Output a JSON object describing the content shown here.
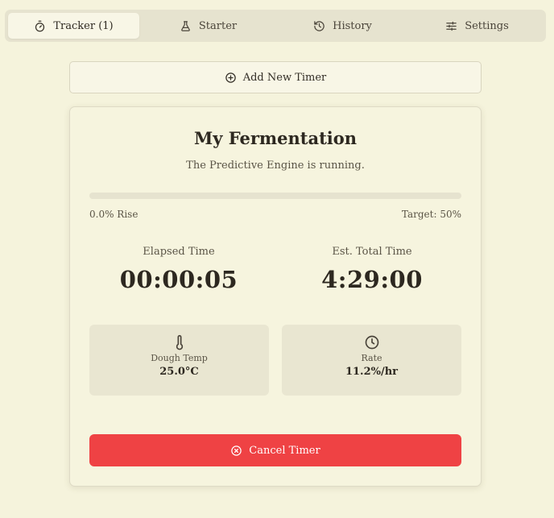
{
  "tabs": [
    {
      "label": "Tracker (1)",
      "icon": "stopwatch-icon",
      "active": true
    },
    {
      "label": "Starter",
      "icon": "flask-icon",
      "active": false
    },
    {
      "label": "History",
      "icon": "history-icon",
      "active": false
    },
    {
      "label": "Settings",
      "icon": "sliders-icon",
      "active": false
    }
  ],
  "add_timer": {
    "label": "Add New Timer",
    "icon": "plus-circle-icon"
  },
  "card": {
    "title": "My Fermentation",
    "subtitle": "The Predictive Engine is running.",
    "progress": {
      "value_percent": 0,
      "rise_label": "0.0% Rise",
      "target_label": "Target: 50%"
    },
    "elapsed": {
      "label": "Elapsed Time",
      "value": "00:00:05"
    },
    "estimated": {
      "label": "Est. Total Time",
      "value": "4:29:00"
    },
    "dough_temp": {
      "label": "Dough Temp",
      "value": "25.0°C",
      "icon": "thermometer-icon"
    },
    "rate": {
      "label": "Rate",
      "value": "11.2%/hr",
      "icon": "clock-icon"
    },
    "cancel": {
      "label": "Cancel Timer",
      "icon": "x-circle-icon"
    }
  },
  "colors": {
    "background": "#f5f3dc",
    "card": "#f6f4de",
    "cancel": "#ef4244",
    "text": "#2d2820"
  }
}
